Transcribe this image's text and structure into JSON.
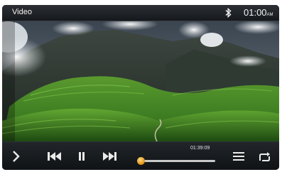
{
  "status_bar": {
    "title": "Video",
    "bluetooth_icon": "bluetooth-icon",
    "time": "01:00",
    "time_suffix": "AM"
  },
  "video": {
    "content": "mountain-landscape-frame"
  },
  "controls": {
    "icons": {
      "nav": "chevron-right-icon",
      "prev": "skip-previous-icon",
      "pause": "pause-icon",
      "next": "skip-next-icon",
      "list": "menu-list-icon",
      "repeat": "repeat-icon"
    },
    "elapsed_time": "01:39:09",
    "progress_fraction": 0.0
  },
  "colors": {
    "bar_background": "#16191c",
    "text": "#f2f2f2",
    "knob": "#e59a1a"
  }
}
